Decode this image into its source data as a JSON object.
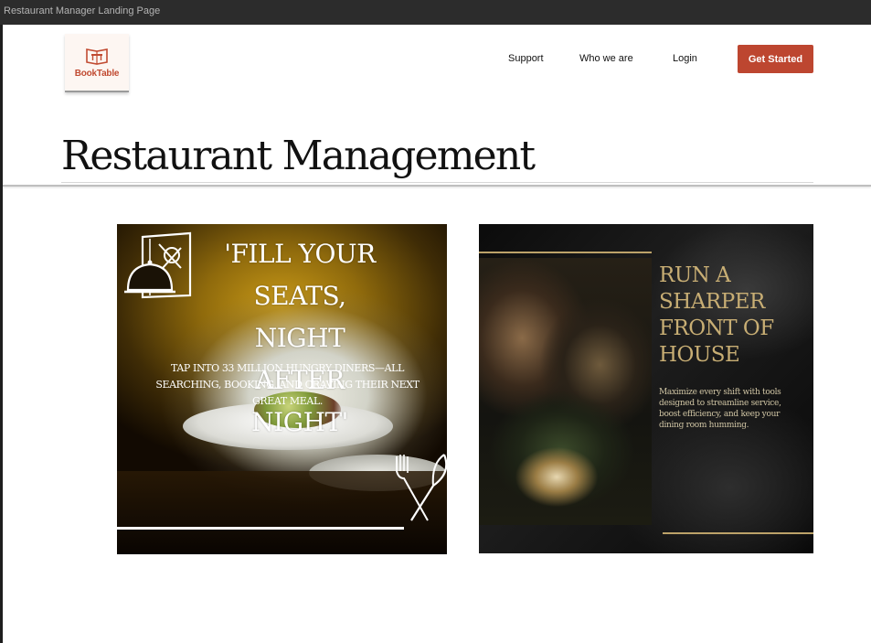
{
  "window": {
    "title": "Restaurant Manager Landing Page"
  },
  "header": {
    "logo_text": "BookTable",
    "nav": {
      "support": "Support",
      "who_we_are": "Who we are",
      "login": "Login"
    },
    "cta_label": "Get Started"
  },
  "main": {
    "page_title": "Restaurant Management",
    "cards": [
      {
        "headline": "'FILL YOUR SEATS, NIGHT AFTER NIGHT'",
        "subtext": "TAP INTO 33 MILLION HUNGRY DINERS—ALL SEARCHING, BOOKING, AND CRAVING THEIR NEXT GREAT MEAL."
      },
      {
        "headline": "RUN A SHARPER FRONT OF HOUSE",
        "subtext": "Maximize every shift with tools designed to streamline service, boost efficiency, and keep your dining room humming."
      }
    ]
  },
  "colors": {
    "brand": "#bd4630",
    "gold": "#bca269"
  },
  "icons": [
    "book-table-logo-icon",
    "menu-cloche-icon",
    "fork-knife-icon"
  ]
}
